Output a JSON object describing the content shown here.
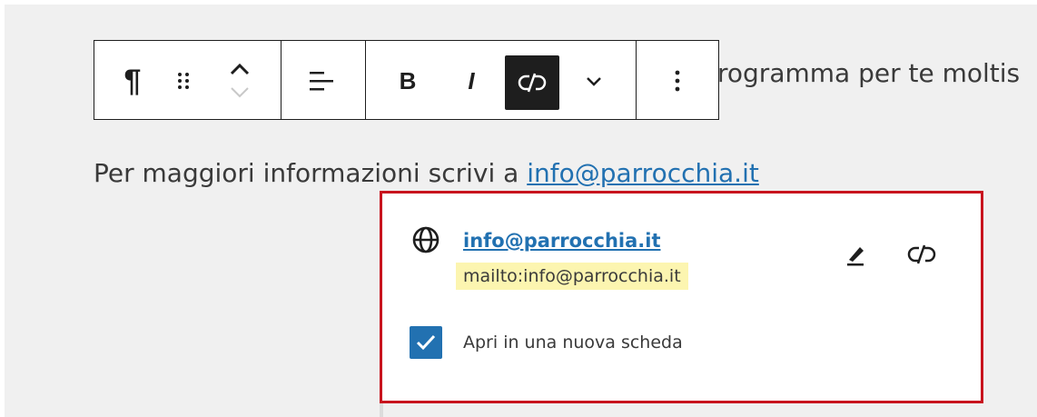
{
  "paragraph_top": {
    "text": "rogramma per te moltis"
  },
  "paragraph_bottom": {
    "prefix": "Per maggiori informazioni scrivi a ",
    "link_text": "info@parrocchia.it"
  },
  "toolbar": {
    "items": [
      {
        "name": "paragraph-icon",
        "glyph": "¶"
      },
      {
        "name": "drag-handle-icon"
      },
      {
        "name": "move-up-icon"
      },
      {
        "name": "move-down-icon"
      },
      {
        "name": "align-icon"
      },
      {
        "name": "bold-button",
        "label": "B"
      },
      {
        "name": "italic-button",
        "label": "I"
      },
      {
        "name": "unlink-button",
        "active": true
      },
      {
        "name": "more-formatting-chevron-icon"
      },
      {
        "name": "options-kebab-icon"
      }
    ]
  },
  "link_popover": {
    "title": "info@parrocchia.it",
    "url": "mailto:info@parrocchia.it",
    "open_new_tab_label": "Apri in una nuova scheda",
    "open_new_tab_checked": true
  },
  "colors": {
    "accent": "#2271b1",
    "highlight_border": "#c8141e",
    "url_highlight": "#fcf5b0",
    "active_button": "#1e1e1e"
  }
}
